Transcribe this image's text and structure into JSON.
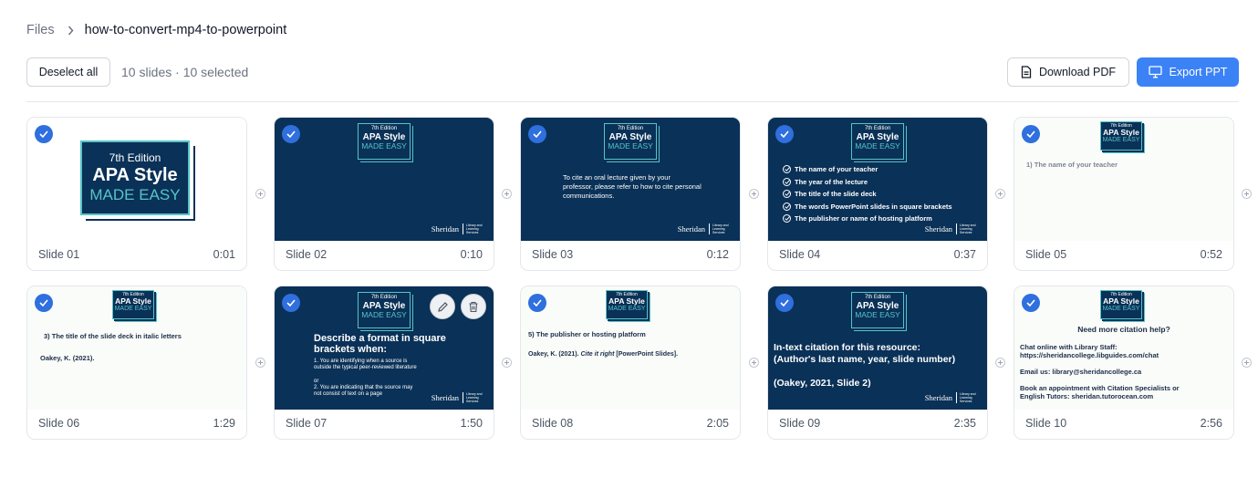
{
  "breadcrumb": {
    "root": "Files",
    "current": "how-to-convert-mp4-to-powerpoint"
  },
  "toolbar": {
    "deselect_label": "Deselect all",
    "count_text": "10 slides · 10 selected",
    "download_label": "Download PDF",
    "export_label": "Export PPT"
  },
  "colors": {
    "accent": "#3b82f6",
    "slide_dark": "#0a3157",
    "slide_teal": "#56c4c8"
  },
  "logo": {
    "edition": "7th Edition",
    "title": "APA Style",
    "subtitle": "MADE EASY"
  },
  "brand": {
    "name": "Sheridan",
    "tag": "Library and Learning Services"
  },
  "slides": [
    {
      "label": "Slide 01",
      "time": "0:01"
    },
    {
      "label": "Slide 02",
      "time": "0:10"
    },
    {
      "label": "Slide 03",
      "time": "0:12",
      "body": "To cite an oral lecture given by your professor, please refer to how to cite personal communications."
    },
    {
      "label": "Slide 04",
      "time": "0:37",
      "items": [
        "The name of your teacher",
        "The year of the lecture",
        "The title of the slide deck",
        "The words PowerPoint slides in square brackets",
        "The publisher or name of hosting platform"
      ]
    },
    {
      "label": "Slide 05",
      "time": "0:52",
      "body": "1) The name of your teacher"
    },
    {
      "label": "Slide 06",
      "time": "1:29",
      "line1": "3) The title of the slide deck in italic letters",
      "line2": "Oakey, K. (2021)."
    },
    {
      "label": "Slide 07",
      "time": "1:50",
      "heading": "Describe a format in square brackets when:",
      "p1": "1. You are identifying when a source is outside the typical peer-reviewed literature",
      "or": "or",
      "p2": "2. You are indicating that the source may not consist of text on a page"
    },
    {
      "label": "Slide 08",
      "time": "2:05",
      "line1": "5) The publisher or hosting platform",
      "cite_a": "Oakey, K. (2021). ",
      "cite_b": "Cite it right",
      "cite_c": " [PowerPoint Slides]."
    },
    {
      "label": "Slide 09",
      "time": "2:35",
      "line1": "In-text citation for this resource:",
      "line2": "(Author's last name, year, slide number)",
      "line3": "(Oakey, 2021, Slide 2)"
    },
    {
      "label": "Slide 10",
      "time": "2:56",
      "heading": "Need more citation help?",
      "l1": "Chat online with Library Staff:",
      "l2": "https://sheridancollege.libguides.com/chat",
      "l3": "Email us: library@sheridancollege.ca",
      "l4": "Book an appointment with Citation Specialists or",
      "l5": "English Tutors: sheridan.tutorocean.com"
    }
  ]
}
